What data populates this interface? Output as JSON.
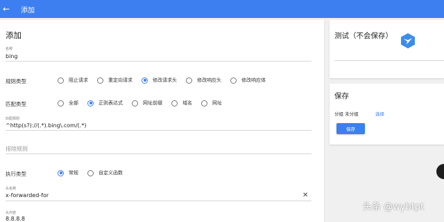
{
  "header": {
    "back_icon": "←",
    "title": "添加"
  },
  "form": {
    "title": "添加",
    "name": {
      "label": "名称",
      "value": "bing"
    },
    "rule_type": {
      "label": "规则类型",
      "options": [
        "阻止请求",
        "重定向请求",
        "修改请求头",
        "修改响应头",
        "修改响应体"
      ],
      "selected": "修改请求头"
    },
    "match_type": {
      "label": "匹配类型",
      "options": [
        "全部",
        "正则表达式",
        "网址前缀",
        "域名",
        "网址"
      ],
      "selected": "正则表达式"
    },
    "match_rule": {
      "label": "匹配规则",
      "value": "^http(s?)://(.*).bing\\.com/(.*)"
    },
    "exclude_rule": {
      "placeholder": "排除规则"
    },
    "exec_type": {
      "label": "执行类型",
      "options": [
        "常规",
        "自定义函数"
      ],
      "selected": "常规"
    },
    "header_name": {
      "label": "头名称",
      "value": "x-forwarded-for",
      "clear_icon": "✕"
    },
    "header_value": {
      "label": "头内容",
      "value": "8.8.8.8"
    }
  },
  "test_card": {
    "title": "测试（不会保存）"
  },
  "save_card": {
    "title": "保存",
    "group_label": "分组",
    "group_value": "未分组",
    "select_link": "选择",
    "save_button": "保存"
  },
  "watermark": "头条 @wybtpt",
  "colors": {
    "accent": "#3d7ff0",
    "background": "#f0f0f0"
  },
  "icons": {
    "logo": "bird-logo-icon",
    "back": "arrow-left-icon",
    "clear": "close-icon",
    "fab": "floating-action-button"
  }
}
